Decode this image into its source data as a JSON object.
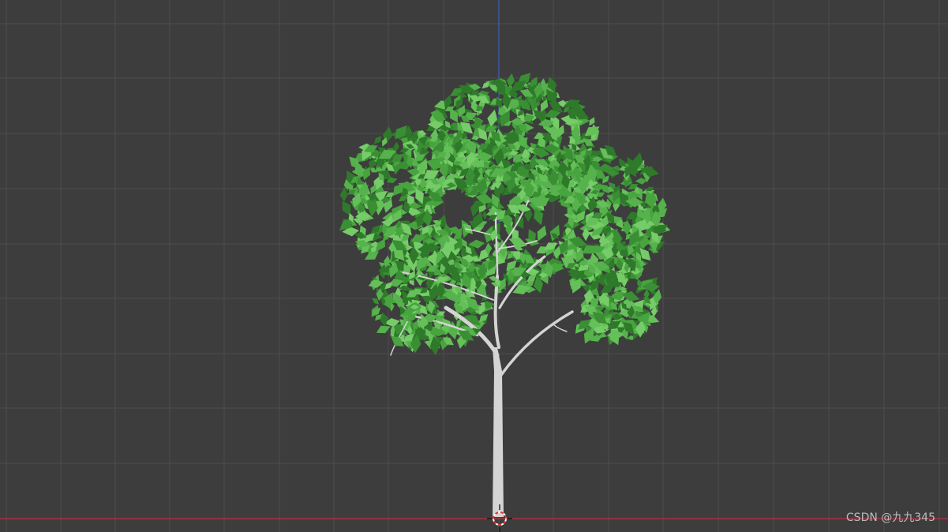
{
  "viewport": {
    "background_color": "#3d3d3d",
    "grid_color": "#4d4d4d",
    "x_axis_color": "#b8333f",
    "z_axis_color": "#3a62b5"
  },
  "object": {
    "name_icon": "tree-icon",
    "leaf_colors": [
      "#2f7a2a",
      "#3a8f34",
      "#48a43f",
      "#56b24c",
      "#66c05a",
      "#76cc68"
    ],
    "trunk_color": "#d4d4d4"
  },
  "cursor_3d": {
    "icon": "3d-cursor-icon"
  },
  "watermark": {
    "text": "CSDN @九九345"
  }
}
